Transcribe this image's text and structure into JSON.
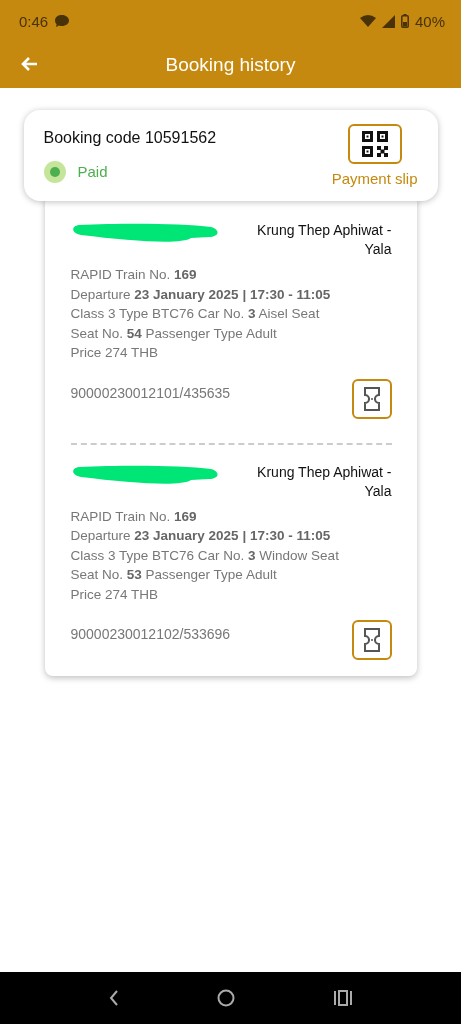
{
  "status_bar": {
    "time": "0:46",
    "battery": "40%"
  },
  "app_bar": {
    "title": "Booking history"
  },
  "booking": {
    "code": "Booking code 10591562",
    "status": "Paid",
    "payment_slip": "Payment slip"
  },
  "tickets": [
    {
      "route": "Krung Thep Aphiwat - Yala",
      "lines": [
        "RAPID Train No. **169**",
        "Departure **23 January 2025 | 17:30 - 11:05**",
        "Class 3 Type BTC76 Car No. **3**  Aisel Seat",
        "Seat No. **54** Passenger Type Adult",
        "Price 274 THB"
      ],
      "ticket_no": "90000230012101/435635"
    },
    {
      "route": "Krung Thep Aphiwat - Yala",
      "lines": [
        "RAPID Train No. **169**",
        "Departure **23 January 2025 | 17:30 - 11:05**",
        "Class 3 Type BTC76 Car No. **3**  Window Seat",
        "Seat No. **53** Passenger Type Adult",
        "Price 274 THB"
      ],
      "ticket_no": "90000230012102/533696"
    }
  ]
}
